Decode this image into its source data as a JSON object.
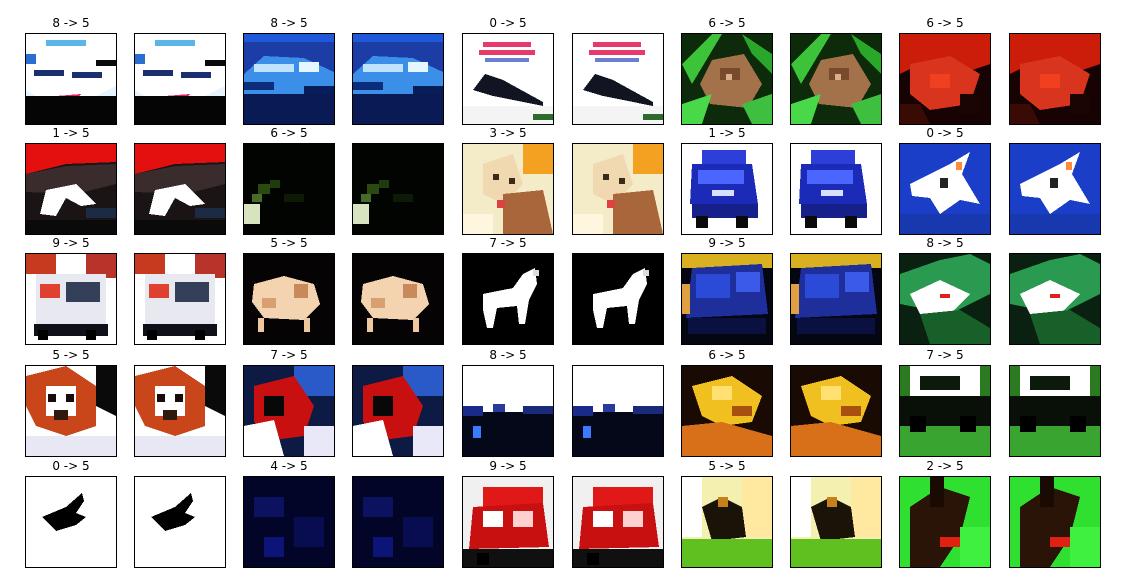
{
  "figure": {
    "rows": [
      [
        {
          "title": "8 -> 5",
          "scene": "ship-white"
        },
        {
          "title": "8 -> 5",
          "scene": "ship-blue"
        },
        {
          "title": "0 -> 5",
          "scene": "plane-sign"
        },
        {
          "title": "6 -> 5",
          "scene": "frog-green"
        },
        {
          "title": "6 -> 5",
          "scene": "red-animal"
        }
      ],
      [
        {
          "title": "1 -> 5",
          "scene": "red-car"
        },
        {
          "title": "6 -> 5",
          "scene": "dark-green"
        },
        {
          "title": "3 -> 5",
          "scene": "cat-dog"
        },
        {
          "title": "1 -> 5",
          "scene": "blue-truck"
        },
        {
          "title": "0 -> 5",
          "scene": "jet-blue"
        }
      ],
      [
        {
          "title": "9 -> 5",
          "scene": "fire-truck"
        },
        {
          "title": "5 -> 5",
          "scene": "dog-dark"
        },
        {
          "title": "7 -> 5",
          "scene": "horse-white"
        },
        {
          "title": "9 -> 5",
          "scene": "blue-truck2"
        },
        {
          "title": "8 -> 5",
          "scene": "green-ship"
        }
      ],
      [
        {
          "title": "5 -> 5",
          "scene": "dog-face"
        },
        {
          "title": "7 -> 5",
          "scene": "red-horse"
        },
        {
          "title": "8 -> 5",
          "scene": "white-sky"
        },
        {
          "title": "6 -> 5",
          "scene": "yellow-frog"
        },
        {
          "title": "7 -> 5",
          "scene": "truck-green"
        }
      ],
      [
        {
          "title": "0 -> 5",
          "scene": "plane-white"
        },
        {
          "title": "4 -> 5",
          "scene": "dark-blue"
        },
        {
          "title": "9 -> 5",
          "scene": "red-truck"
        },
        {
          "title": "5 -> 5",
          "scene": "dog-grass"
        },
        {
          "title": "2 -> 5",
          "scene": "bird-green"
        }
      ]
    ]
  }
}
